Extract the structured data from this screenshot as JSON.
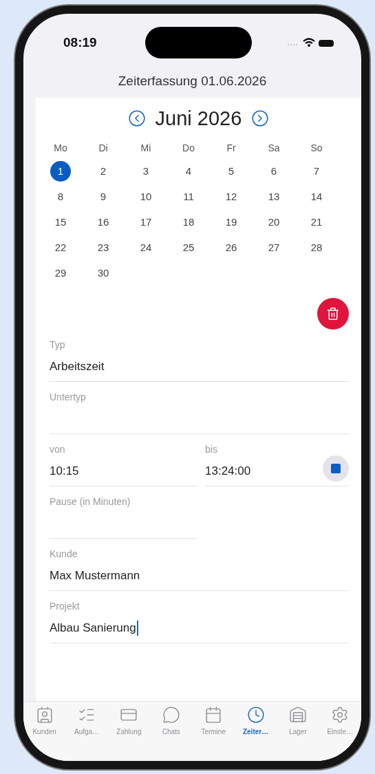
{
  "status_bar": {
    "time": "08:19"
  },
  "title": "Zeiterfassung 01.06.2026",
  "calendar": {
    "month": "Juni 2026",
    "weekdays": [
      "Mo",
      "Di",
      "Mi",
      "Do",
      "Fr",
      "Sa",
      "So"
    ],
    "days": [
      {
        "label": "1",
        "selected": true
      },
      {
        "label": "2",
        "selected": false
      },
      {
        "label": "3",
        "selected": false
      },
      {
        "label": "4",
        "selected": false
      },
      {
        "label": "5",
        "selected": false
      },
      {
        "label": "6",
        "selected": false
      },
      {
        "label": "7",
        "selected": false
      },
      {
        "label": "8",
        "selected": false
      },
      {
        "label": "9",
        "selected": false
      },
      {
        "label": "10",
        "selected": false
      },
      {
        "label": "11",
        "selected": false
      },
      {
        "label": "12",
        "selected": false
      },
      {
        "label": "13",
        "selected": false
      },
      {
        "label": "14",
        "selected": false
      },
      {
        "label": "15",
        "selected": false
      },
      {
        "label": "16",
        "selected": false
      },
      {
        "label": "17",
        "selected": false
      },
      {
        "label": "18",
        "selected": false
      },
      {
        "label": "19",
        "selected": false
      },
      {
        "label": "20",
        "selected": false
      },
      {
        "label": "21",
        "selected": false
      },
      {
        "label": "22",
        "selected": false
      },
      {
        "label": "23",
        "selected": false
      },
      {
        "label": "24",
        "selected": false
      },
      {
        "label": "25",
        "selected": false
      },
      {
        "label": "26",
        "selected": false
      },
      {
        "label": "27",
        "selected": false
      },
      {
        "label": "28",
        "selected": false
      },
      {
        "label": "29",
        "selected": false
      },
      {
        "label": "30",
        "selected": false
      }
    ]
  },
  "form": {
    "fields": [
      {
        "kind": "text",
        "label": "Typ",
        "value": "Arbeitszeit"
      },
      {
        "kind": "text",
        "label": "Untertyp"
      },
      {
        "kind": "range",
        "from": {
          "label": "von",
          "value": "10:15"
        },
        "to": {
          "label": "bis",
          "value": "13:24:00"
        }
      },
      {
        "kind": "half",
        "label": "Pause (in Minuten)"
      },
      {
        "kind": "text",
        "label": "Kunde",
        "value": "Max Mustermann"
      },
      {
        "kind": "text",
        "label": "Projekt",
        "value": "Albau Sanierung",
        "focused": true
      }
    ]
  },
  "tab_bar": [
    {
      "label": "Kunden",
      "selected": false
    },
    {
      "label": "Aufga…",
      "selected": false
    },
    {
      "label": "Zahlung",
      "selected": false
    },
    {
      "label": "Chats",
      "selected": false
    },
    {
      "label": "Termine",
      "selected": false
    },
    {
      "label": "Zeiter…",
      "selected": true
    },
    {
      "label": "Lager",
      "selected": false
    },
    {
      "label": "Einste…",
      "selected": false
    }
  ]
}
